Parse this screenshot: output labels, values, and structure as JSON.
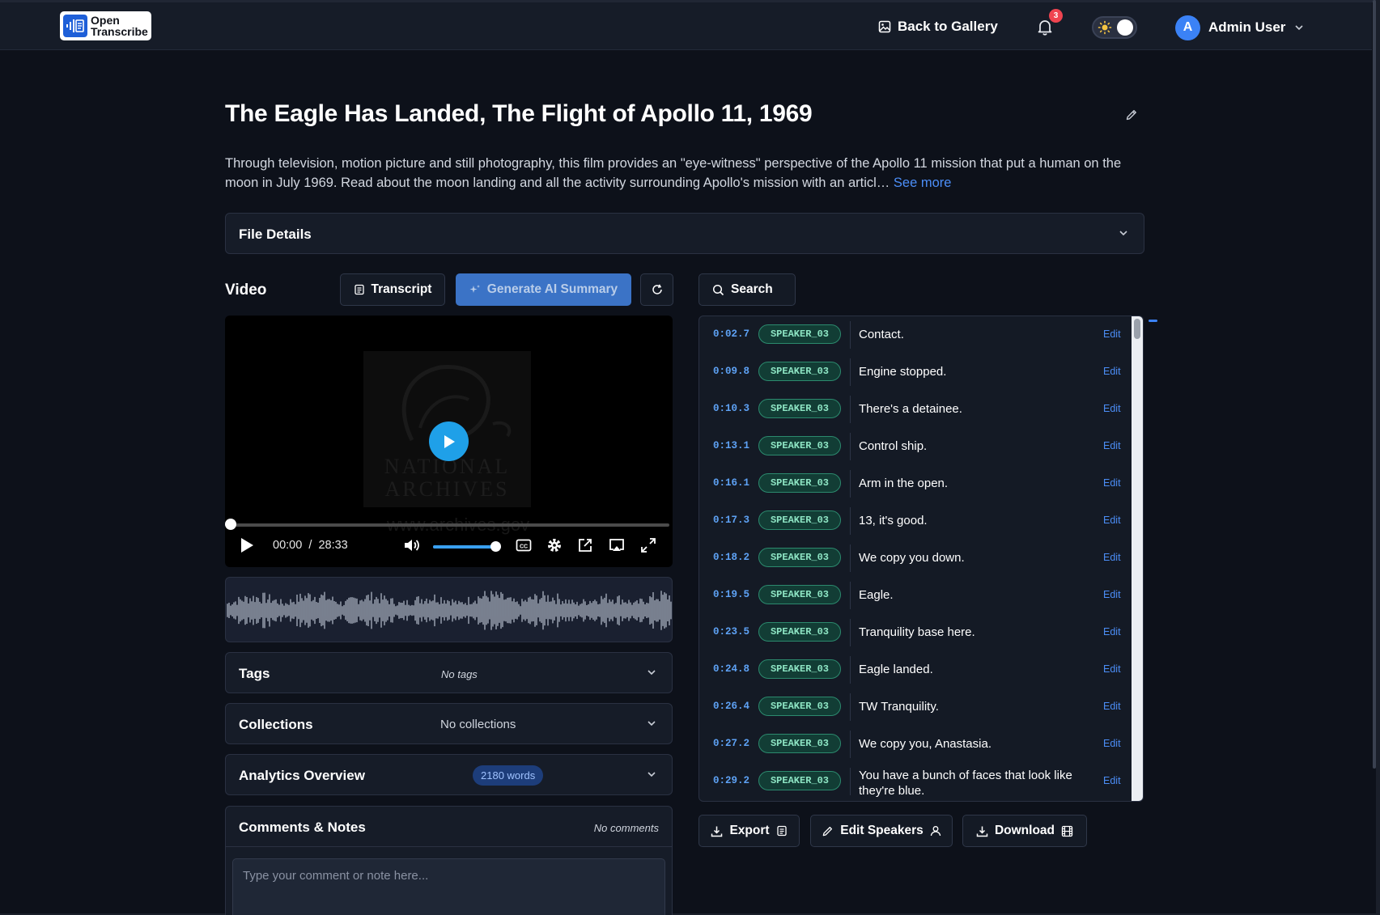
{
  "header": {
    "logo_line1": "Open",
    "logo_line2": "Transcribe",
    "back_label": "Back to Gallery",
    "notification_count": "3",
    "user_initial": "A",
    "user_name": "Admin User",
    "icons": [
      "image-icon",
      "bell-icon",
      "sun-icon",
      "chevron-down-icon"
    ]
  },
  "media": {
    "title": "The Eagle Has Landed, The Flight of Apollo 11, 1969",
    "description": "Through television, motion picture and still photography, this film provides an \"eye-witness\" perspective of the Apollo 11 mission that put a human on the moon in July 1969. Read about the moon landing and all the activity surrounding Apollo's mission with an articl…",
    "see_more": "See more"
  },
  "file_details": {
    "label": "File Details"
  },
  "toolbar": {
    "section_label": "Video",
    "transcript_label": "Transcript",
    "ai_summary_label": "Generate AI Summary",
    "search_label": "Search"
  },
  "player": {
    "current_time": "00:00",
    "separator": "/",
    "duration": "28:33",
    "progress": 0,
    "volume": 0.92,
    "poster_line1": "NATIONAL",
    "poster_line2": "ARCHIVES",
    "watermark": "www.archives.gov"
  },
  "tags": {
    "label": "Tags",
    "value": "No tags"
  },
  "collections": {
    "label": "Collections",
    "value": "No collections"
  },
  "analytics": {
    "label": "Analytics Overview",
    "badge": "2180 words"
  },
  "comments": {
    "label": "Comments & Notes",
    "meta": "No comments",
    "placeholder": "Type your comment or note here..."
  },
  "transcript": {
    "edit_label": "Edit",
    "segments": [
      {
        "time": "0:02.7",
        "speaker": "SPEAKER_03",
        "text": "Contact."
      },
      {
        "time": "0:09.8",
        "speaker": "SPEAKER_03",
        "text": "Engine stopped."
      },
      {
        "time": "0:10.3",
        "speaker": "SPEAKER_03",
        "text": "There's a detainee."
      },
      {
        "time": "0:13.1",
        "speaker": "SPEAKER_03",
        "text": "Control ship."
      },
      {
        "time": "0:16.1",
        "speaker": "SPEAKER_03",
        "text": "Arm in the open."
      },
      {
        "time": "0:17.3",
        "speaker": "SPEAKER_03",
        "text": "13, it's good."
      },
      {
        "time": "0:18.2",
        "speaker": "SPEAKER_03",
        "text": "We copy you down."
      },
      {
        "time": "0:19.5",
        "speaker": "SPEAKER_03",
        "text": "Eagle."
      },
      {
        "time": "0:23.5",
        "speaker": "SPEAKER_03",
        "text": "Tranquility base here."
      },
      {
        "time": "0:24.8",
        "speaker": "SPEAKER_03",
        "text": "Eagle landed."
      },
      {
        "time": "0:26.4",
        "speaker": "SPEAKER_03",
        "text": "TW Tranquility."
      },
      {
        "time": "0:27.2",
        "speaker": "SPEAKER_03",
        "text": "We copy you, Anastasia."
      },
      {
        "time": "0:29.2",
        "speaker": "SPEAKER_03",
        "text": "You have a bunch of faces that look like they're blue."
      }
    ]
  },
  "actions": {
    "export_label": "Export",
    "edit_speakers_label": "Edit Speakers",
    "download_label": "Download"
  },
  "colors": {
    "background": "#0d111a",
    "panel": "#161c28",
    "accent": "#4c8ef7",
    "speaker_badge": "#123d35",
    "play_button": "#1fa0e8"
  }
}
